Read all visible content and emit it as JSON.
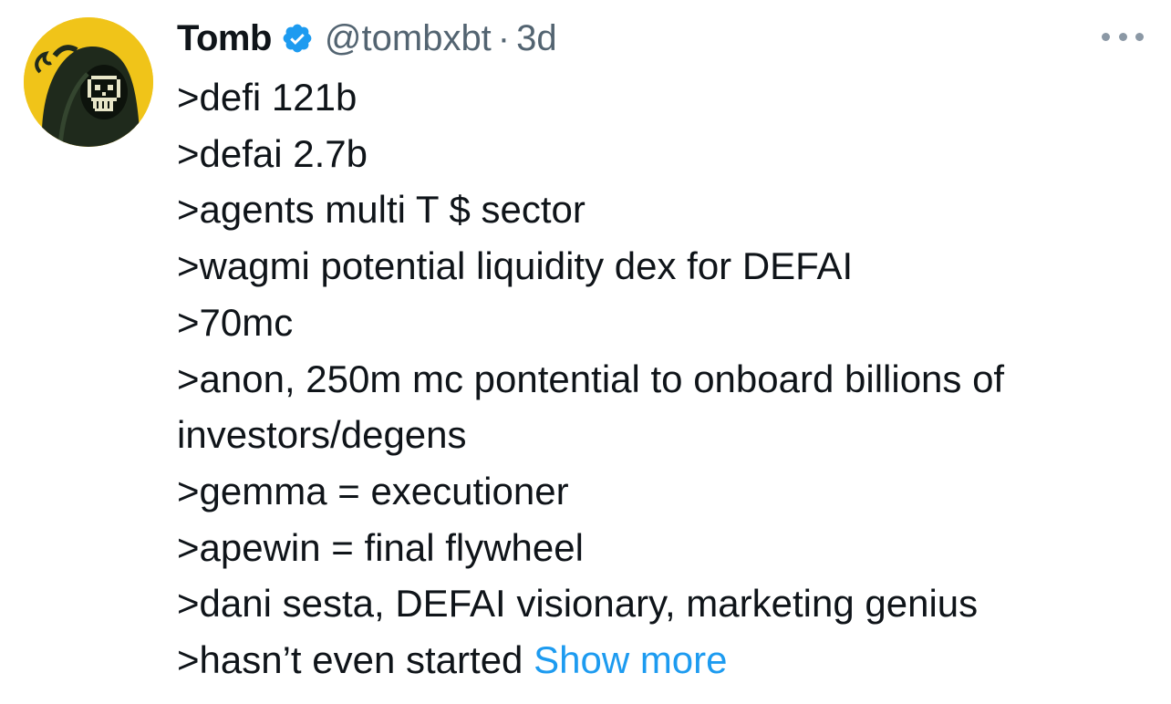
{
  "author": {
    "name": "Tomb",
    "handle": "@tombxbt",
    "separator": "·",
    "time": "3d",
    "verified": true,
    "avatar_icon": "hooded-pixel-skull-avatar",
    "verified_icon": "verified-badge-icon",
    "verified_color": "#1d9bf0"
  },
  "menu_icon": "more-options-icon",
  "body": {
    "lines": [
      ">defi 121b",
      ">defai 2.7b",
      ">agents multi T $ sector",
      ">wagmi potential liquidity dex for DEFAI",
      ">70mc",
      ">anon, 250m mc pontential to onboard billions of",
      "investors/degens",
      ">gemma = executioner",
      ">apewin = final flywheel",
      ">dani sesta, DEFAI visionary, marketing genius"
    ],
    "last_line": ">hasn’t even started",
    "show_more": "Show more"
  },
  "colors": {
    "text": "#0f1419",
    "secondary": "#536471",
    "link": "#1d9bf0"
  }
}
